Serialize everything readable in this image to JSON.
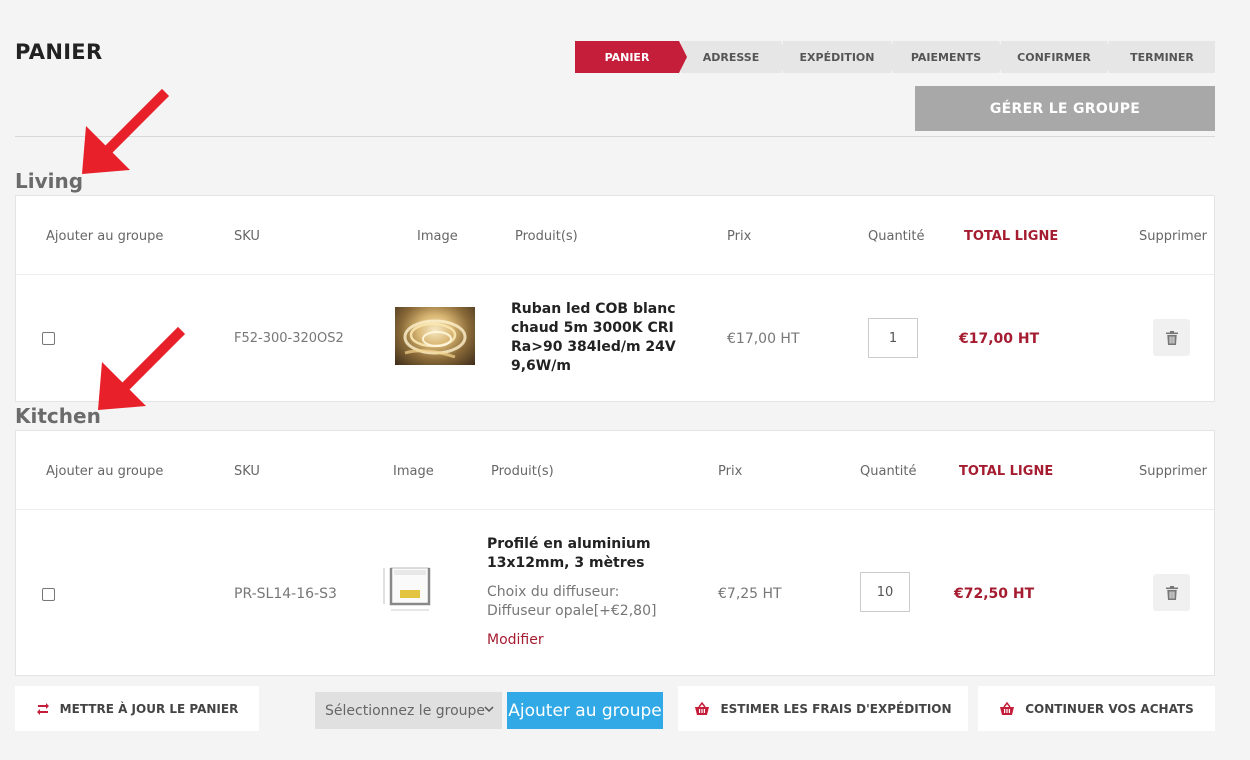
{
  "page": {
    "title": "PANIER"
  },
  "steps": [
    {
      "label": "PANIER",
      "active": true
    },
    {
      "label": "ADRESSE"
    },
    {
      "label": "EXPÉDITION"
    },
    {
      "label": "PAIEMENTS"
    },
    {
      "label": "CONFIRMER"
    },
    {
      "label": "TERMINER"
    }
  ],
  "manage_group": {
    "label": "GÉRER LE GROUPE"
  },
  "table_headers": {
    "add_to_group": "Ajouter au groupe",
    "sku": "SKU",
    "image": "Image",
    "products": "Produit(s)",
    "price": "Prix",
    "quantity": "Quantité",
    "line_total": "TOTAL LIGNE",
    "remove": "Supprimer"
  },
  "groups": [
    {
      "name": "Living",
      "items": [
        {
          "sku": "F52-300-320OS2",
          "name_lines": [
            "Ruban led COB blanc",
            "chaud 5m 3000K CRI",
            "Ra>90 384led/m 24V",
            "9,6W/m"
          ],
          "price": "€17,00 HT",
          "quantity": "1",
          "line_total": "€17,00 HT"
        }
      ]
    },
    {
      "name": "Kitchen",
      "items": [
        {
          "sku": "PR-SL14-16-S3",
          "name_lines": [
            "Profilé en aluminium",
            "13x12mm, 3 mètres"
          ],
          "option_lines": [
            "Choix du diffuseur:",
            "Diffuseur opale[+€2,80]"
          ],
          "modify_label": "Modifier",
          "price": "€7,25 HT",
          "quantity": "10",
          "line_total": "€72,50 HT"
        }
      ]
    }
  ],
  "footer": {
    "update_cart": "METTRE À JOUR LE PANIER",
    "select_group": "Sélectionnez le groupe",
    "add_to_group": "Ajouter au groupe",
    "estimate_shipping": "ESTIMER LES FRAIS D'EXPÉDITION",
    "continue_shopping": "CONTINUER VOS ACHATS"
  },
  "colors": {
    "accent": "#c41e3a",
    "total_text": "#a51c30",
    "manage_button": "#a8a8a8",
    "add_button": "#31a9e6",
    "annotation_arrow": "#e8202a"
  },
  "icons": [
    "trash-icon",
    "refresh-icon",
    "basket-icon",
    "chevron-down-icon",
    "red-arrow-annotation"
  ]
}
